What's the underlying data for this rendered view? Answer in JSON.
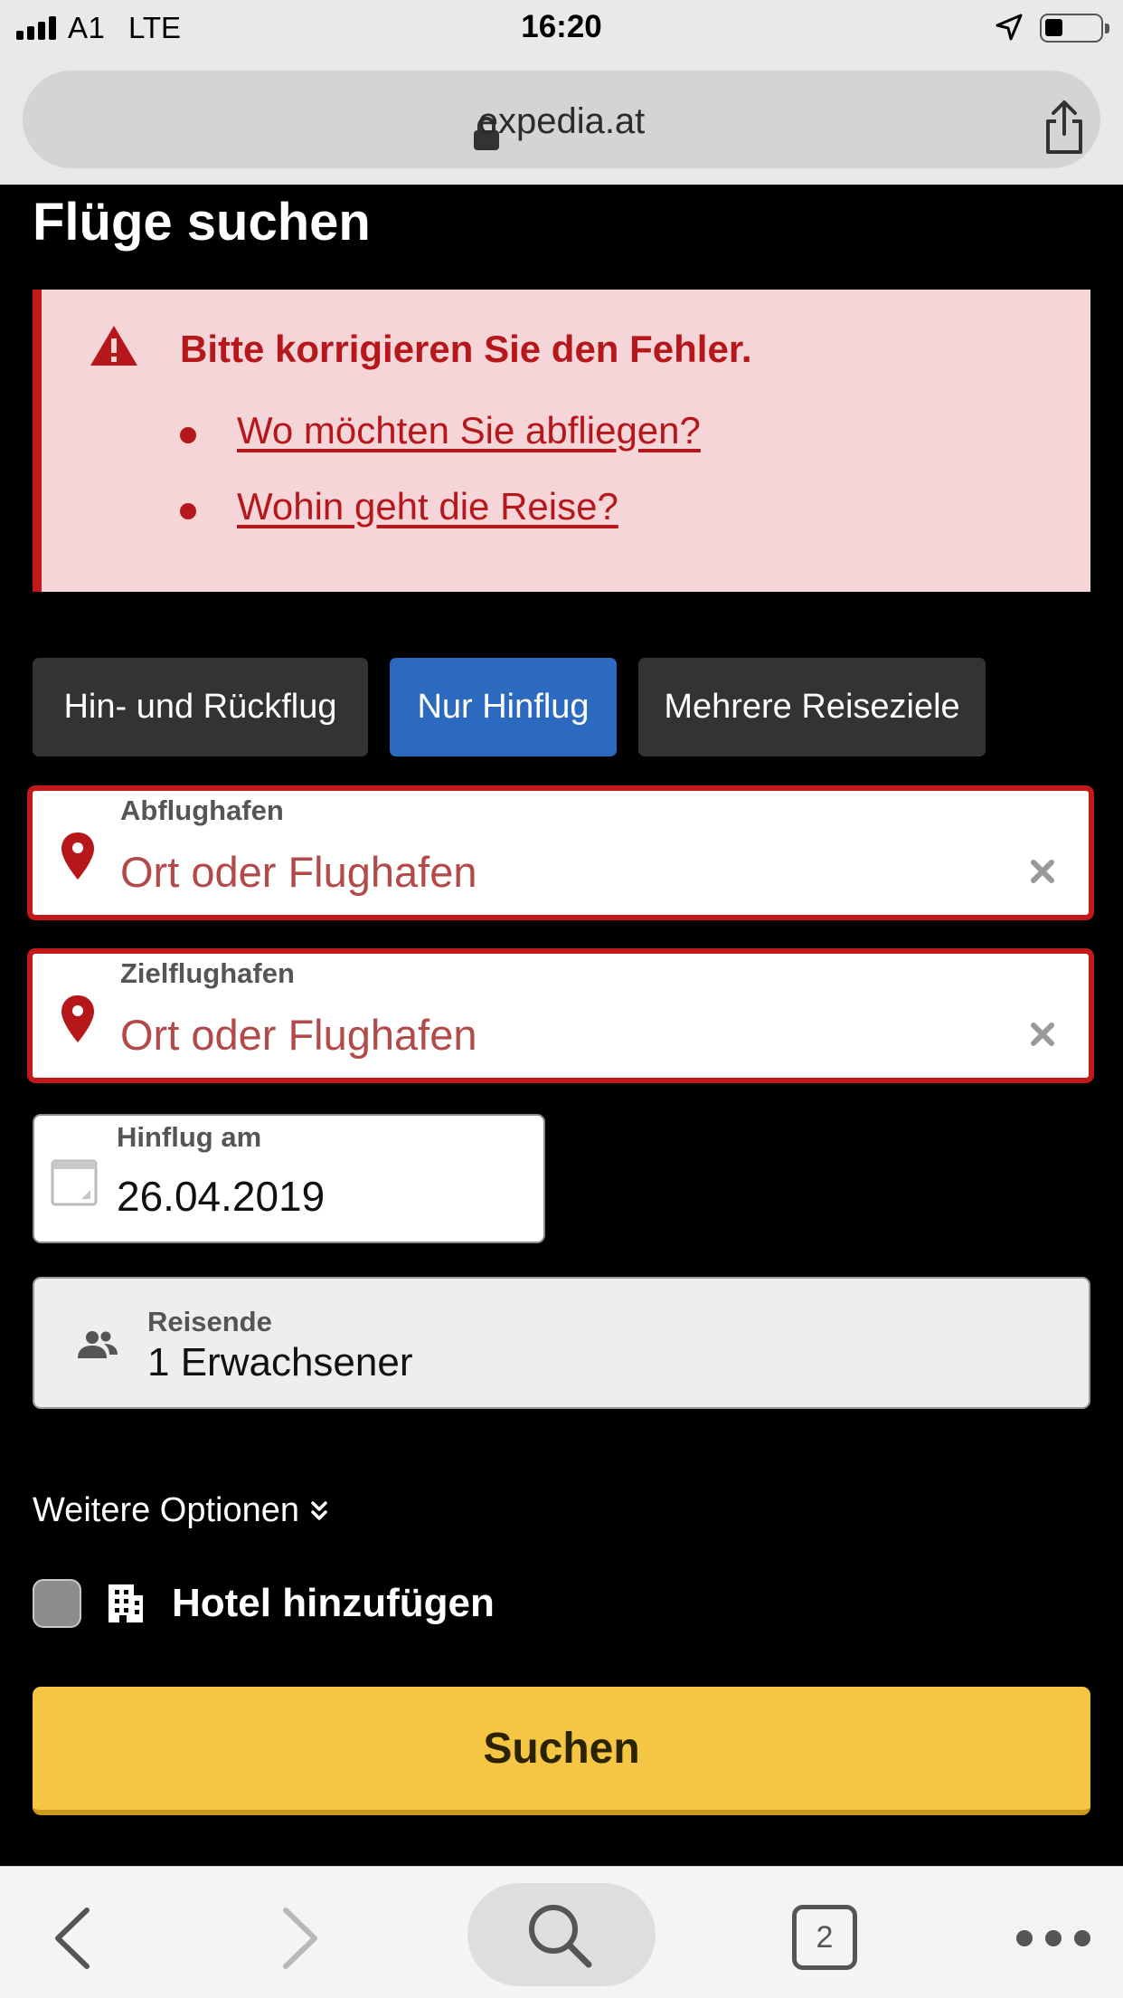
{
  "status_bar": {
    "carrier": "A1",
    "network": "LTE",
    "time": "16:20",
    "signal_icon": "signal-bars-icon",
    "location_icon": "location-arrow-icon",
    "battery_icon": "battery-icon",
    "battery_level": 0.3
  },
  "browser": {
    "url": "expedia.at",
    "lock_icon": "lock-icon",
    "share_icon": "share-icon"
  },
  "page": {
    "title": "Flüge suchen"
  },
  "error": {
    "title": "Bitte korrigieren Sie den Fehler.",
    "icon": "warning-icon",
    "items": [
      "Wo möchten Sie abfliegen?",
      "Wohin geht die Reise?"
    ]
  },
  "trip_types": [
    {
      "label": "Hin- und Rückflug",
      "selected": false
    },
    {
      "label": "Nur Hinflug",
      "selected": true
    },
    {
      "label": "Mehrere Reiseziele",
      "selected": false
    }
  ],
  "origin": {
    "label": "Abflughafen",
    "placeholder": "Ort oder Flughafen",
    "icon": "map-pin-icon"
  },
  "destination": {
    "label": "Zielflughafen",
    "placeholder": "Ort oder Flughafen",
    "icon": "map-pin-icon"
  },
  "departure_date": {
    "label": "Hinflug am",
    "value": "26.04.2019",
    "icon": "calendar-icon"
  },
  "travellers": {
    "label": "Reisende",
    "value": "1 Erwachsener",
    "icon": "people-icon"
  },
  "more_options": {
    "label": "Weitere Optionen",
    "icon": "double-chevron-down-icon"
  },
  "hotel": {
    "label": "Hotel hinzufügen",
    "checked": false,
    "icon": "building-icon"
  },
  "search_button": {
    "label": "Suchen"
  },
  "toolbar": {
    "tab_count": "2",
    "back_icon": "back-chevron-icon",
    "forward_icon": "forward-chevron-icon",
    "search_icon": "search-icon",
    "more_icon": "more-dots-icon"
  },
  "colors": {
    "error_red": "#c21a1a",
    "error_bg": "#f5d5d8",
    "selected_blue": "#2c6abf",
    "search_yellow": "#f5c544"
  }
}
